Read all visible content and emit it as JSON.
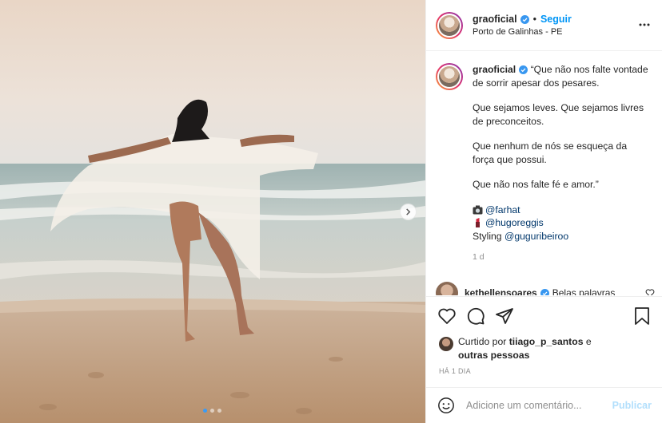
{
  "post": {
    "username": "graoficial",
    "separator": "•",
    "follow_label": "Seguir",
    "location": "Porto de Galinhas - PE",
    "more_icon": "more-options-icon"
  },
  "caption": {
    "username": "graoficial",
    "line1": "“Que não nos falte vontade de sorrir apesar dos pesares.",
    "line2": "Que sejamos leves. Que sejamos livres de preconceitos.",
    "line3": "Que nenhum de nós se esqueça da força que possui.",
    "line4": "Que não nos falte fé e amor.”",
    "credit1": "@farhat",
    "credit2": "@hugoreggis",
    "credit3_prefix": "Styling ",
    "credit3": "@guguribeiroo",
    "age": "1 d"
  },
  "comment": {
    "username": "kethellensoares",
    "text": "Belas palavras"
  },
  "liked_by": {
    "prefix": "Curtido por ",
    "user": "tiiago_p_santos",
    "middle": " e ",
    "others": "outras pessoas"
  },
  "date": "HÁ 1 DIA",
  "add_comment": {
    "placeholder": "Adicione um comentário...",
    "publish_label": "Publicar"
  },
  "carousel": {
    "total": 3,
    "current": 1
  },
  "colors": {
    "link": "#0095f6",
    "mention": "#00376b",
    "muted": "#8e8e8e",
    "publish_disabled": "#b2dffc"
  }
}
